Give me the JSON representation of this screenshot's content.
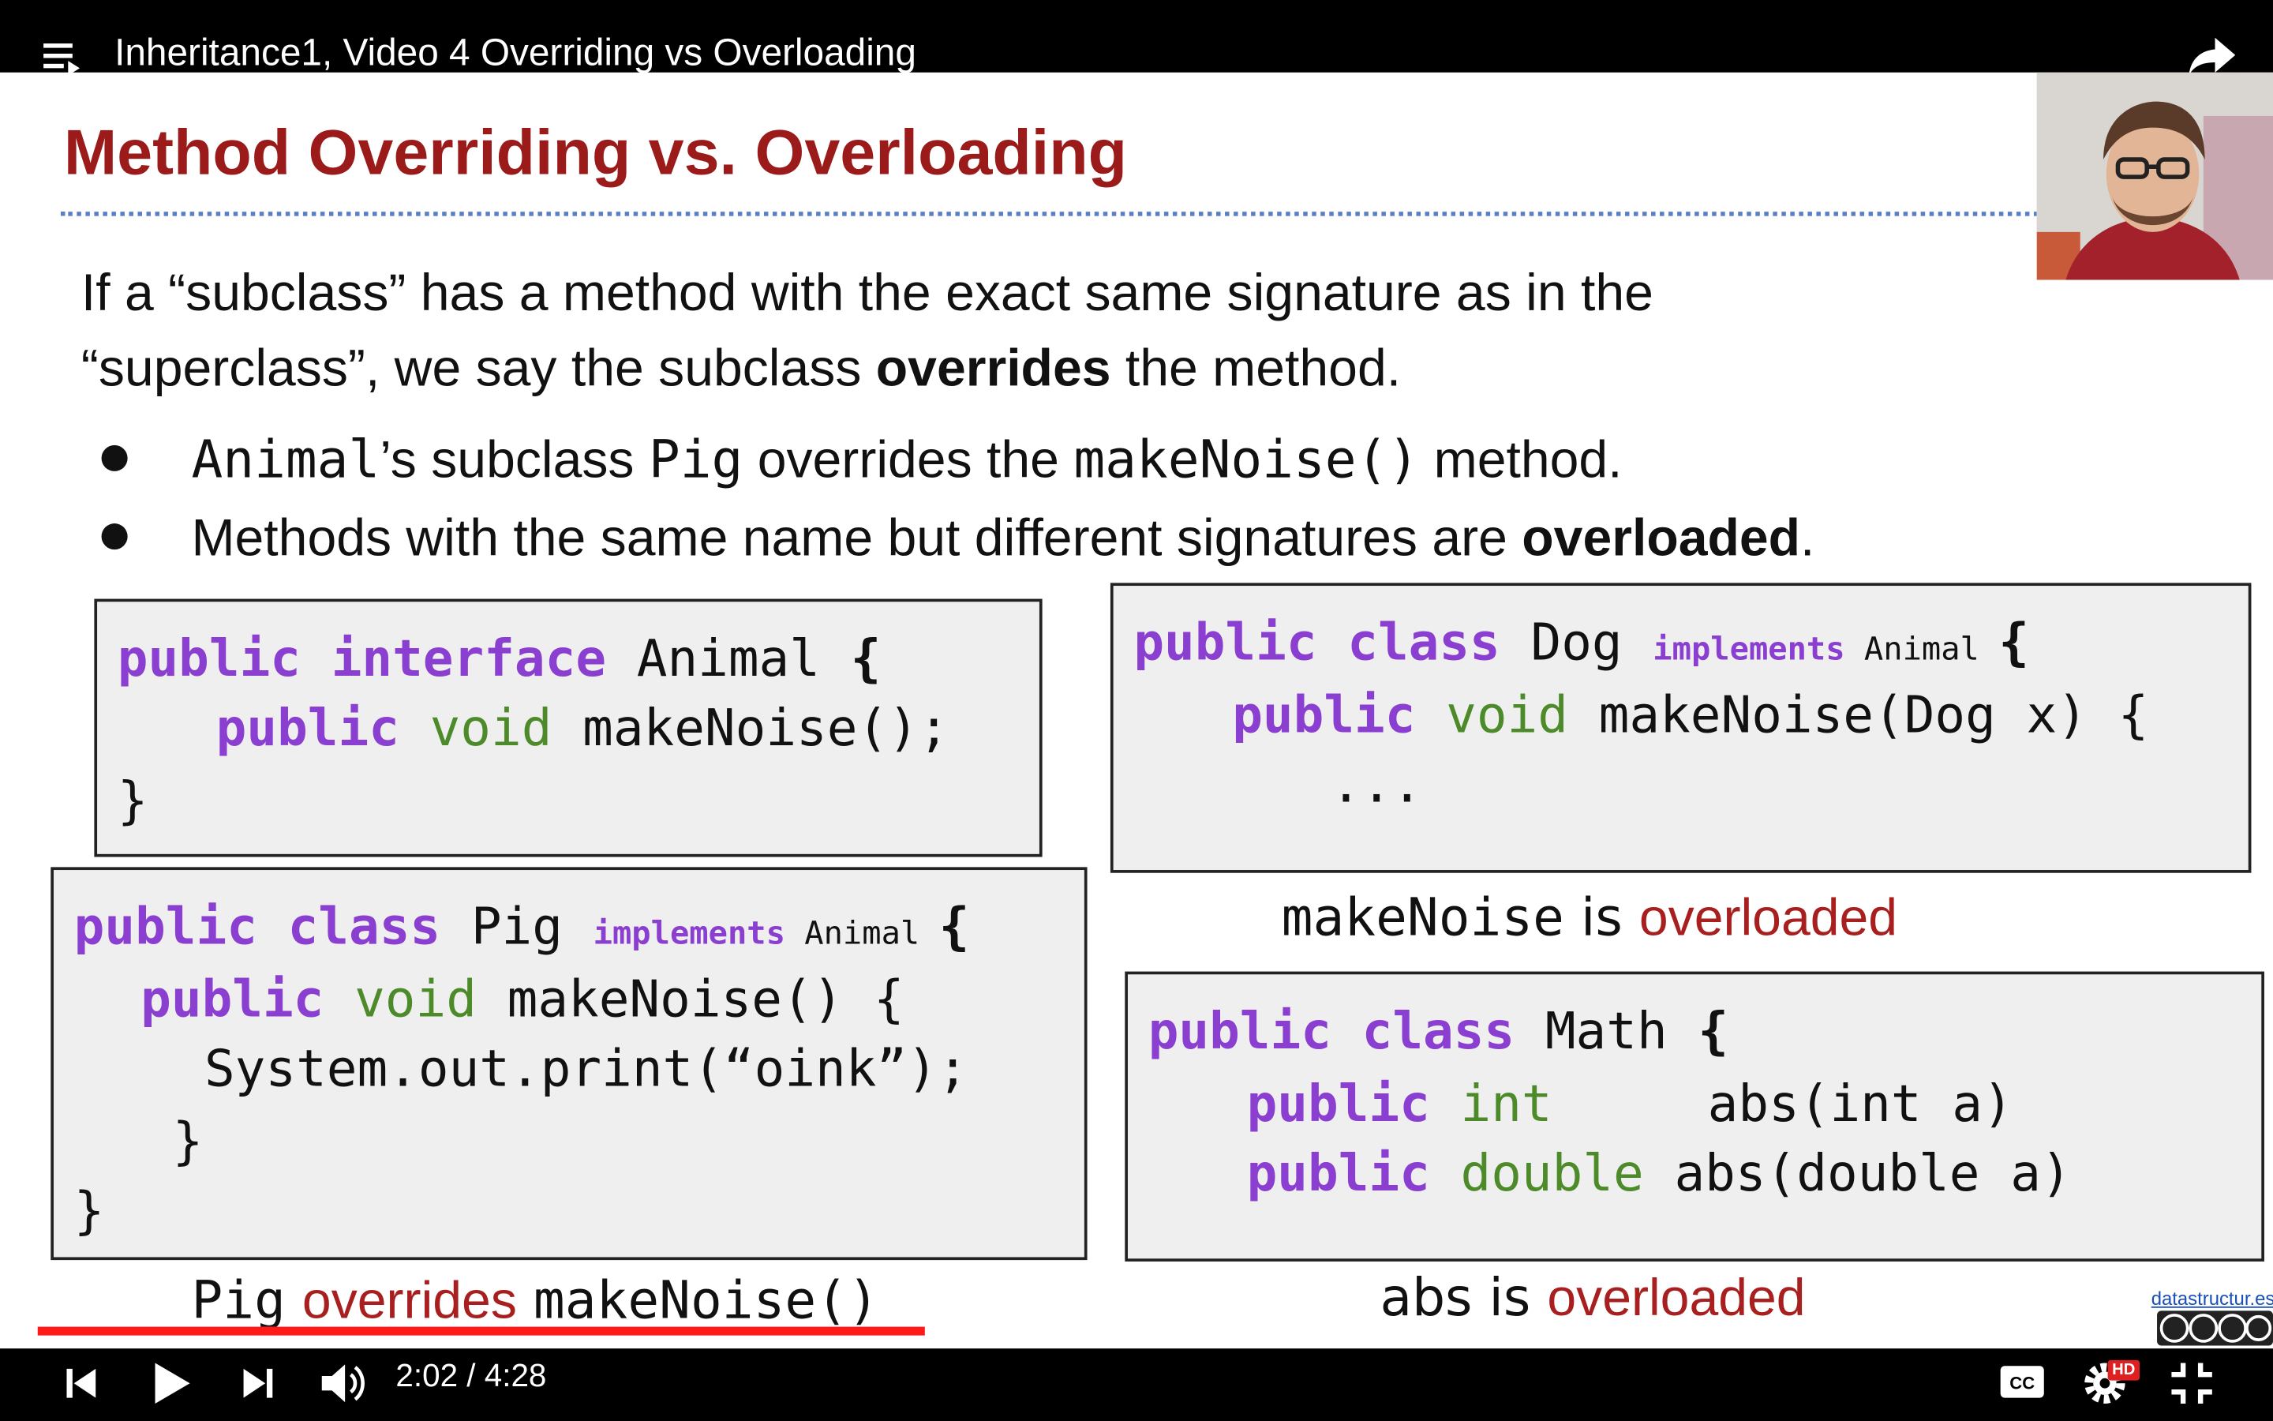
{
  "player": {
    "title": "Inheritance1, Video 4 Overriding vs Overloading",
    "time_display": "2:02 / 4:28",
    "progress": 0.4755,
    "hd_badge": "HD"
  },
  "slide": {
    "title": "Method Overriding vs. Overloading",
    "para_line1": "If a “subclass” has a method with the exact same signature as in the",
    "para_line2_a": "“superclass”, we say the subclass ",
    "para_line2_b": "overrides",
    "para_line2_c": " the method.",
    "bullet1": {
      "a": "Animal",
      "b": "’s subclass ",
      "c": "Pig",
      "d": " overrides the ",
      "e": "makeNoise()",
      "f": " method."
    },
    "bullet2": {
      "a": "Methods with the same name but different signatures are ",
      "b": "overloaded",
      "c": "."
    },
    "animal_code": {
      "l1_kw": "public interface",
      "l1_rest": " Animal ",
      "l1_brace": "{",
      "l2_kw": "public",
      "l2_ty": " void",
      "l2_rest": " makeNoise();",
      "l3": "}"
    },
    "pig_code": {
      "l1_kw": "public class",
      "l1_name": " Pig ",
      "l1_impl": "implements",
      "l1_iface": " Animal ",
      "l1_brace": "{",
      "l2_kw": "public",
      "l2_ty": " void",
      "l2_rest": " makeNoise() {",
      "l3": "System.out.print(“oink”);",
      "l4": "}",
      "l5": "}"
    },
    "pig_caption": {
      "a": "Pig",
      "b": "overrides",
      "c": "makeNoise()"
    },
    "dog_code": {
      "l1_kw": "public class",
      "l1_name": " Dog ",
      "l1_impl": "implements",
      "l1_iface": " Animal ",
      "l1_brace": "{",
      "l2_kw": "public",
      "l2_ty": " void",
      "l2_rest": " makeNoise(Dog x) {",
      "l3": "..."
    },
    "dog_caption": {
      "a": "makeNoise",
      "b": " is ",
      "c": "overloaded"
    },
    "math_code": {
      "l1_kw": "public class",
      "l1_rest": " Math ",
      "l1_brace": "{",
      "l2_kw": "public",
      "l2_ty": " int",
      "l2_rest": "abs(int a)",
      "l3_kw": "public",
      "l3_ty": " double",
      "l3_rest": " abs(double a)"
    },
    "math_caption": {
      "a": "abs is ",
      "b": "overloaded"
    },
    "site": "datastructur.es",
    "colors": {
      "title_red": "#9b1b1b",
      "keyword_purple": "#8a3fd1",
      "type_green": "#4c8a2a",
      "progress_red": "#ff1a1a"
    }
  }
}
